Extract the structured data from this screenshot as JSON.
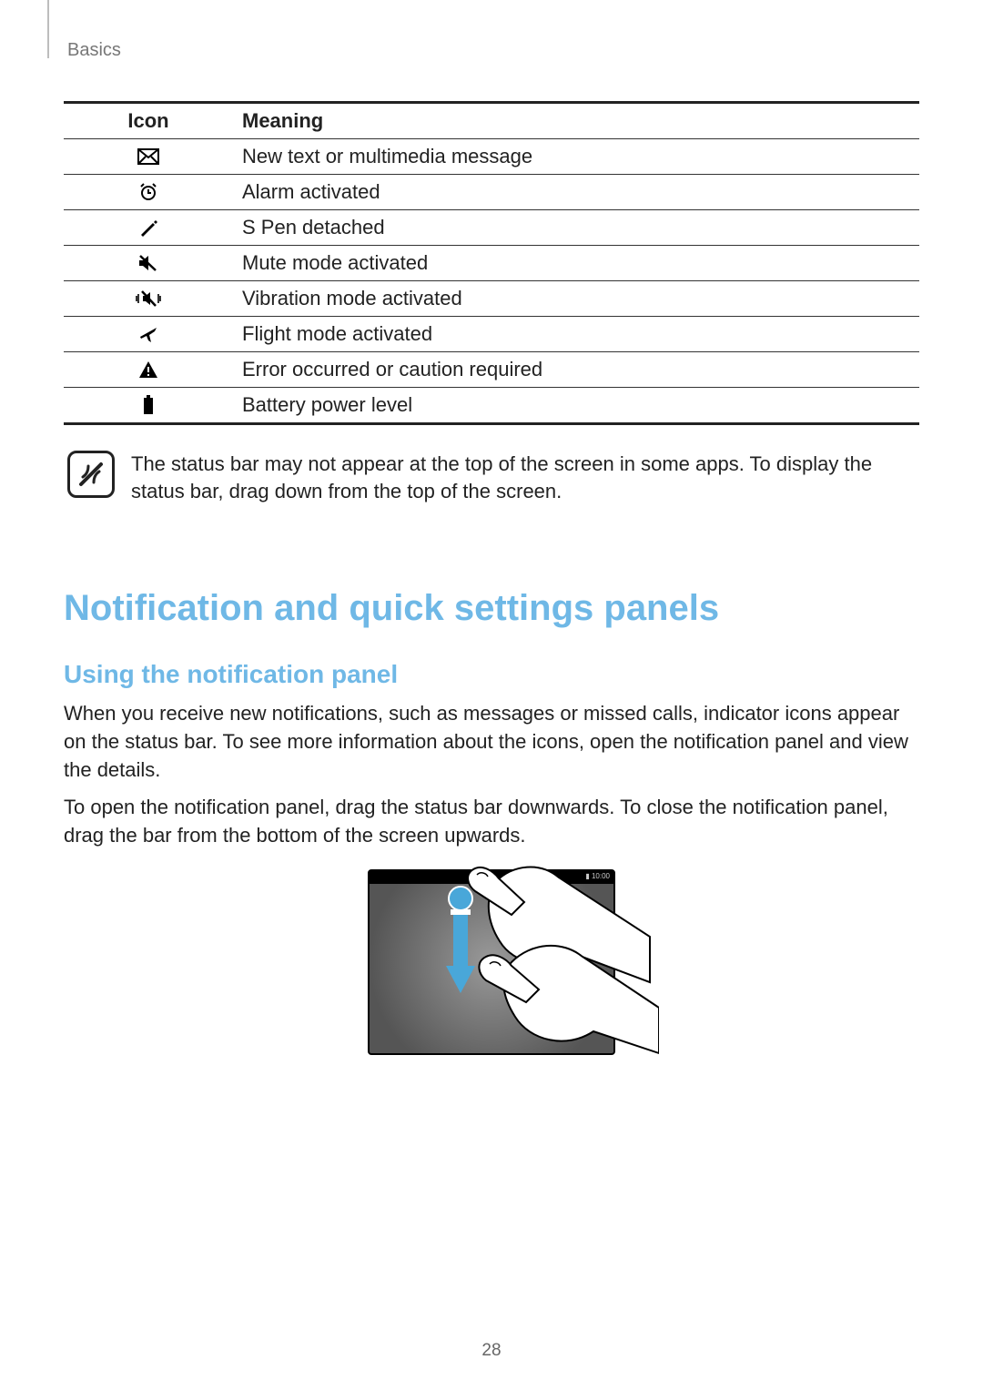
{
  "breadcrumb": "Basics",
  "table": {
    "headers": {
      "icon": "Icon",
      "meaning": "Meaning"
    },
    "rows": [
      {
        "icon_name": "message-icon",
        "meaning": "New text or multimedia message"
      },
      {
        "icon_name": "alarm-icon",
        "meaning": "Alarm activated"
      },
      {
        "icon_name": "spen-icon",
        "meaning": "S Pen detached"
      },
      {
        "icon_name": "mute-icon",
        "meaning": "Mute mode activated"
      },
      {
        "icon_name": "vibration-icon",
        "meaning": "Vibration mode activated"
      },
      {
        "icon_name": "flight-icon",
        "meaning": "Flight mode activated"
      },
      {
        "icon_name": "error-icon",
        "meaning": "Error occurred or caution required"
      },
      {
        "icon_name": "battery-icon",
        "meaning": "Battery power level"
      }
    ]
  },
  "note": "The status bar may not appear at the top of the screen in some apps. To display the status bar, drag down from the top of the screen.",
  "heading": "Notification and quick settings panels",
  "subheading": "Using the notification panel",
  "paragraphs": [
    "When you receive new notifications, such as messages or missed calls, indicator icons appear on the status bar. To see more information about the icons, open the notification panel and view the details.",
    "To open the notification panel, drag the status bar downwards. To close the notification panel, drag the bar from the bottom of the screen upwards."
  ],
  "illustration": {
    "status_time": "10:00",
    "alt": "Drag down from status bar illustration"
  },
  "page_number": "28"
}
